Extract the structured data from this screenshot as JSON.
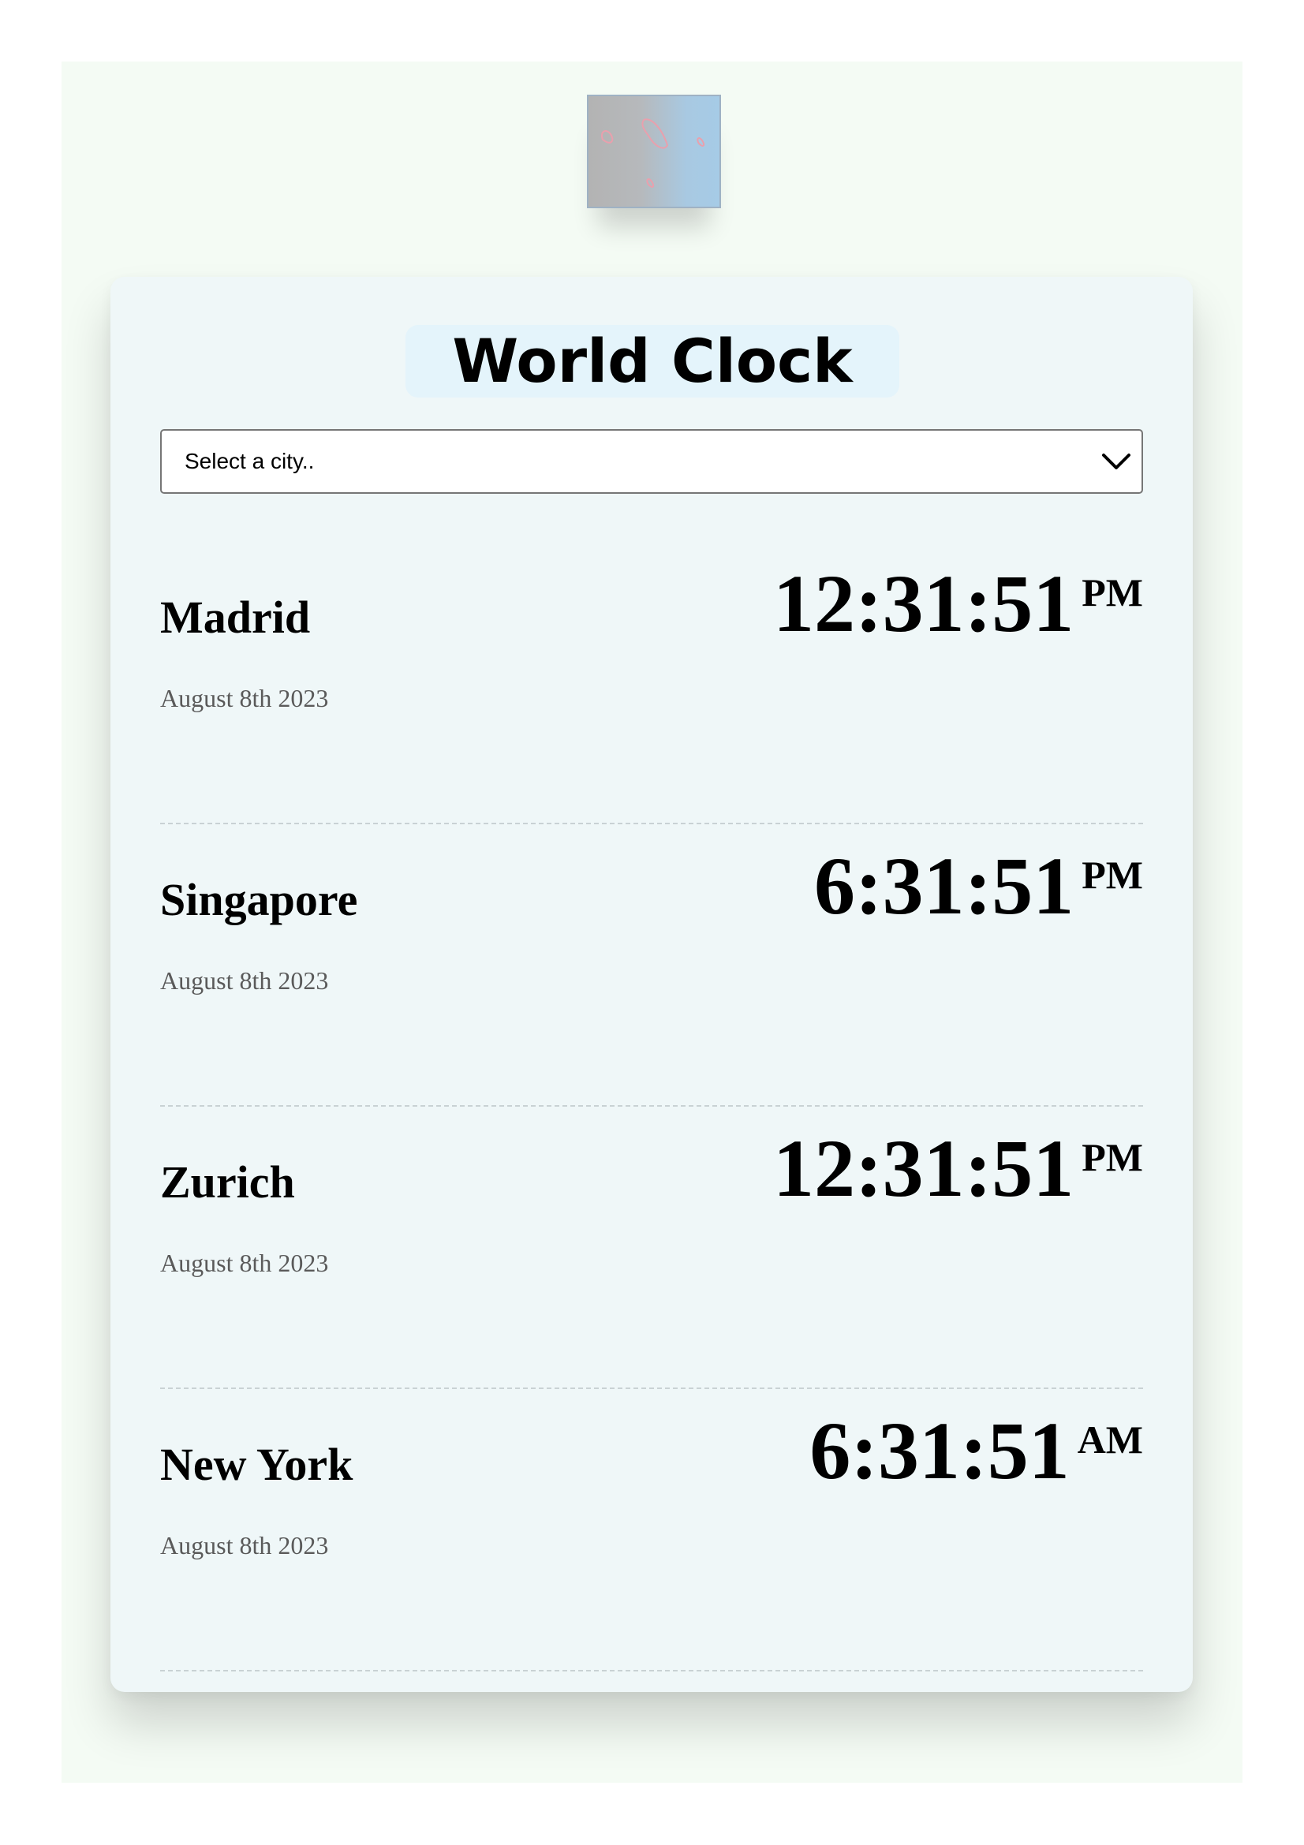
{
  "app": {
    "title": "World Clock",
    "logo_icon": "pink-petals-logo"
  },
  "select": {
    "placeholder": "Select a city.."
  },
  "cities": [
    {
      "name": "Madrid",
      "date": "August 8th 2023",
      "time": "12:31:51",
      "ampm": "PM"
    },
    {
      "name": "Singapore",
      "date": "August 8th 2023",
      "time": "6:31:51",
      "ampm": "PM"
    },
    {
      "name": "Zurich",
      "date": "August 8th 2023",
      "time": "12:31:51",
      "ampm": "PM"
    },
    {
      "name": "New York",
      "date": "August 8th 2023",
      "time": "6:31:51",
      "ampm": "AM"
    }
  ],
  "colors": {
    "page_background": "#f4fbf4",
    "card_background": "#eff7f8",
    "title_highlight": "#e4f4fb",
    "date_text": "#5a5a5a"
  }
}
